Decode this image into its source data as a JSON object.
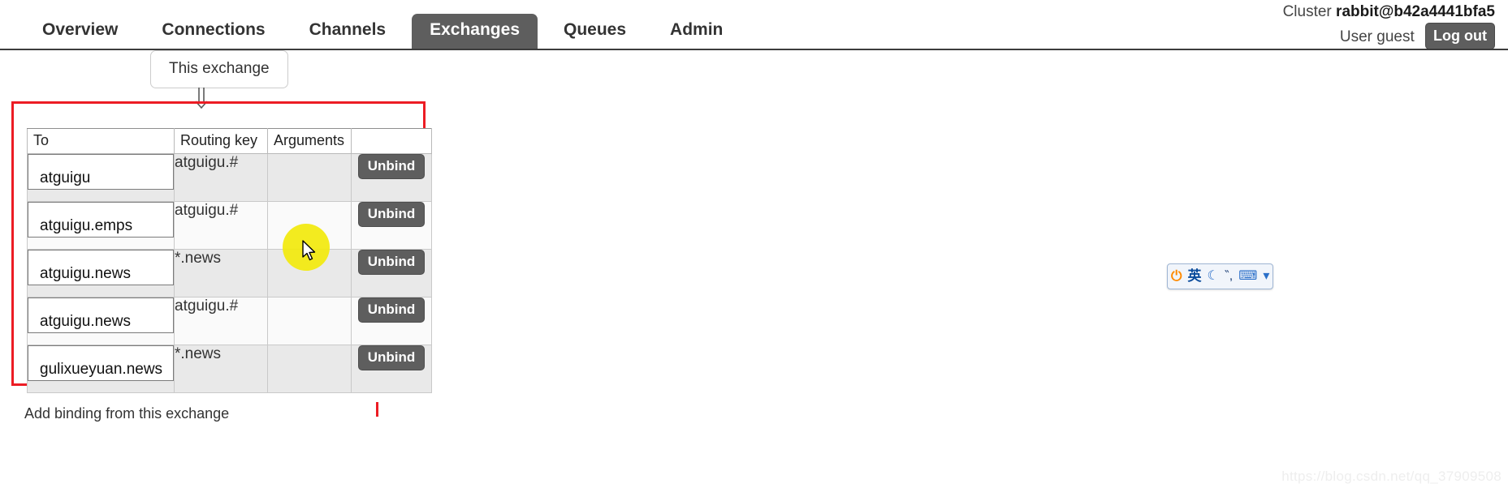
{
  "header": {
    "cluster_label": "Cluster",
    "cluster_name": "rabbit@b42a4441bfa5",
    "user_label": "User",
    "user_name": "guest",
    "logout_label": "Log out"
  },
  "nav": {
    "items": [
      {
        "label": "Overview",
        "active": false
      },
      {
        "label": "Connections",
        "active": false
      },
      {
        "label": "Channels",
        "active": false
      },
      {
        "label": "Exchanges",
        "active": true
      },
      {
        "label": "Queues",
        "active": false
      },
      {
        "label": "Admin",
        "active": false
      }
    ]
  },
  "subnav": {
    "items": [
      {
        "label": "This exchange"
      }
    ]
  },
  "bindings": {
    "columns": [
      "To",
      "Routing key",
      "Arguments",
      ""
    ],
    "unbind_label": "Unbind",
    "rows": [
      {
        "to": "atguigu",
        "routing_key": "atguigu.#",
        "arguments": ""
      },
      {
        "to": "atguigu.emps",
        "routing_key": "atguigu.#",
        "arguments": ""
      },
      {
        "to": "atguigu.news",
        "routing_key": "*.news",
        "arguments": ""
      },
      {
        "to": "atguigu.news",
        "routing_key": "atguigu.#",
        "arguments": ""
      },
      {
        "to": "gulixueyuan.news",
        "routing_key": "*.news",
        "arguments": ""
      }
    ]
  },
  "below": {
    "partial_text": "Add binding from this exchange"
  },
  "ime": {
    "power_icon": "power-icon",
    "language": "英",
    "moon_icon": "moon-icon",
    "punctuation": "‶,",
    "keyboard_icon": "keyboard-icon"
  },
  "watermark": {
    "text": "https://blog.csdn.net/qq_37909508"
  },
  "colors": {
    "annotation_red": "#ec1c24",
    "tab_active_bg": "#5e5e5e",
    "click_highlight": "#f2e90c"
  }
}
